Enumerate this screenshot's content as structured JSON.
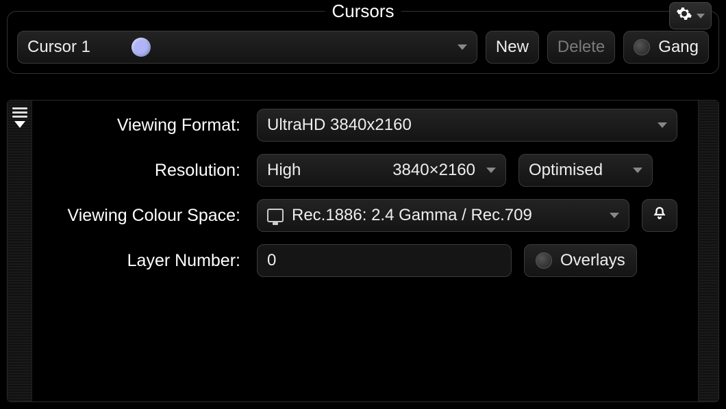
{
  "panel": {
    "title": "Cursors",
    "cursor_selector": {
      "label": "Cursor 1",
      "color": "#aeb4f5"
    },
    "buttons": {
      "new": "New",
      "delete": "Delete",
      "gang": "Gang"
    }
  },
  "settings": {
    "viewing_format": {
      "label": "Viewing Format:",
      "value": "UltraHD 3840x2160"
    },
    "resolution": {
      "label": "Resolution:",
      "quality": "High",
      "dims": "3840×2160",
      "mode": "Optimised"
    },
    "colour_space": {
      "label": "Viewing Colour Space:",
      "value": "Rec.1886: 2.4 Gamma / Rec.709"
    },
    "layer_number": {
      "label": "Layer Number:",
      "value": "0",
      "overlays": "Overlays"
    }
  }
}
